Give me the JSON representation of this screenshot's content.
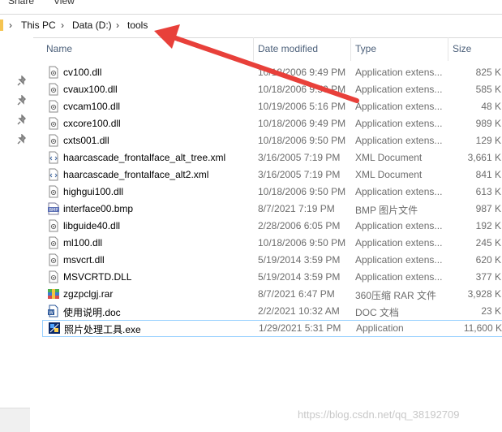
{
  "ribbon": {
    "share_label": "Share",
    "view_label": "View"
  },
  "address": {
    "crumbs": [
      "This PC",
      "Data (D:)",
      "tools"
    ]
  },
  "columns": {
    "name": "Name",
    "date": "Date modified",
    "type": "Type",
    "size": "Size"
  },
  "files": [
    {
      "name": "cv100.dll",
      "date": "10/18/2006 9:49 PM",
      "type": "Application extens...",
      "size": "825 K",
      "icon": "dll-file-icon"
    },
    {
      "name": "cvaux100.dll",
      "date": "10/18/2006 9:50 PM",
      "type": "Application extens...",
      "size": "585 K",
      "icon": "dll-file-icon"
    },
    {
      "name": "cvcam100.dll",
      "date": "10/19/2006 5:16 PM",
      "type": "Application extens...",
      "size": "48 K",
      "icon": "dll-file-icon"
    },
    {
      "name": "cxcore100.dll",
      "date": "10/18/2006 9:49 PM",
      "type": "Application extens...",
      "size": "989 K",
      "icon": "dll-file-icon"
    },
    {
      "name": "cxts001.dll",
      "date": "10/18/2006 9:50 PM",
      "type": "Application extens...",
      "size": "129 K",
      "icon": "dll-file-icon"
    },
    {
      "name": "haarcascade_frontalface_alt_tree.xml",
      "date": "3/16/2005 7:19 PM",
      "type": "XML Document",
      "size": "3,661 K",
      "icon": "xml-file-icon"
    },
    {
      "name": "haarcascade_frontalface_alt2.xml",
      "date": "3/16/2005 7:19 PM",
      "type": "XML Document",
      "size": "841 K",
      "icon": "xml-file-icon"
    },
    {
      "name": "highgui100.dll",
      "date": "10/18/2006 9:50 PM",
      "type": "Application extens...",
      "size": "613 K",
      "icon": "dll-file-icon"
    },
    {
      "name": "interface00.bmp",
      "date": "8/7/2021 7:19 PM",
      "type": "BMP 图片文件",
      "size": "987 K",
      "icon": "bmp-file-icon"
    },
    {
      "name": "libguide40.dll",
      "date": "2/28/2006 6:05 PM",
      "type": "Application extens...",
      "size": "192 K",
      "icon": "dll-file-icon"
    },
    {
      "name": "ml100.dll",
      "date": "10/18/2006 9:50 PM",
      "type": "Application extens...",
      "size": "245 K",
      "icon": "dll-file-icon"
    },
    {
      "name": "msvcrt.dll",
      "date": "5/19/2014 3:59 PM",
      "type": "Application extens...",
      "size": "620 K",
      "icon": "dll-file-icon"
    },
    {
      "name": "MSVCRTD.DLL",
      "date": "5/19/2014 3:59 PM",
      "type": "Application extens...",
      "size": "377 K",
      "icon": "dll-file-icon"
    },
    {
      "name": "zgzpclgj.rar",
      "date": "8/7/2021 6:47 PM",
      "type": "360压缩 RAR 文件",
      "size": "3,928 K",
      "icon": "rar-archive-icon"
    },
    {
      "name": "使用说明.doc",
      "date": "2/2/2021 10:32 AM",
      "type": "DOC 文档",
      "size": "23 K",
      "icon": "doc-file-icon"
    },
    {
      "name": "照片处理工具.exe",
      "date": "1/29/2021 5:31 PM",
      "type": "Application",
      "size": "11,600 K",
      "icon": "exe-app-icon"
    }
  ],
  "selected_index": 15,
  "watermark": "https://blog.csdn.net/qq_38192709",
  "colors": {
    "arrow": "#e8403a",
    "selection_border": "#99d1ff",
    "header_text": "#4c607a"
  }
}
